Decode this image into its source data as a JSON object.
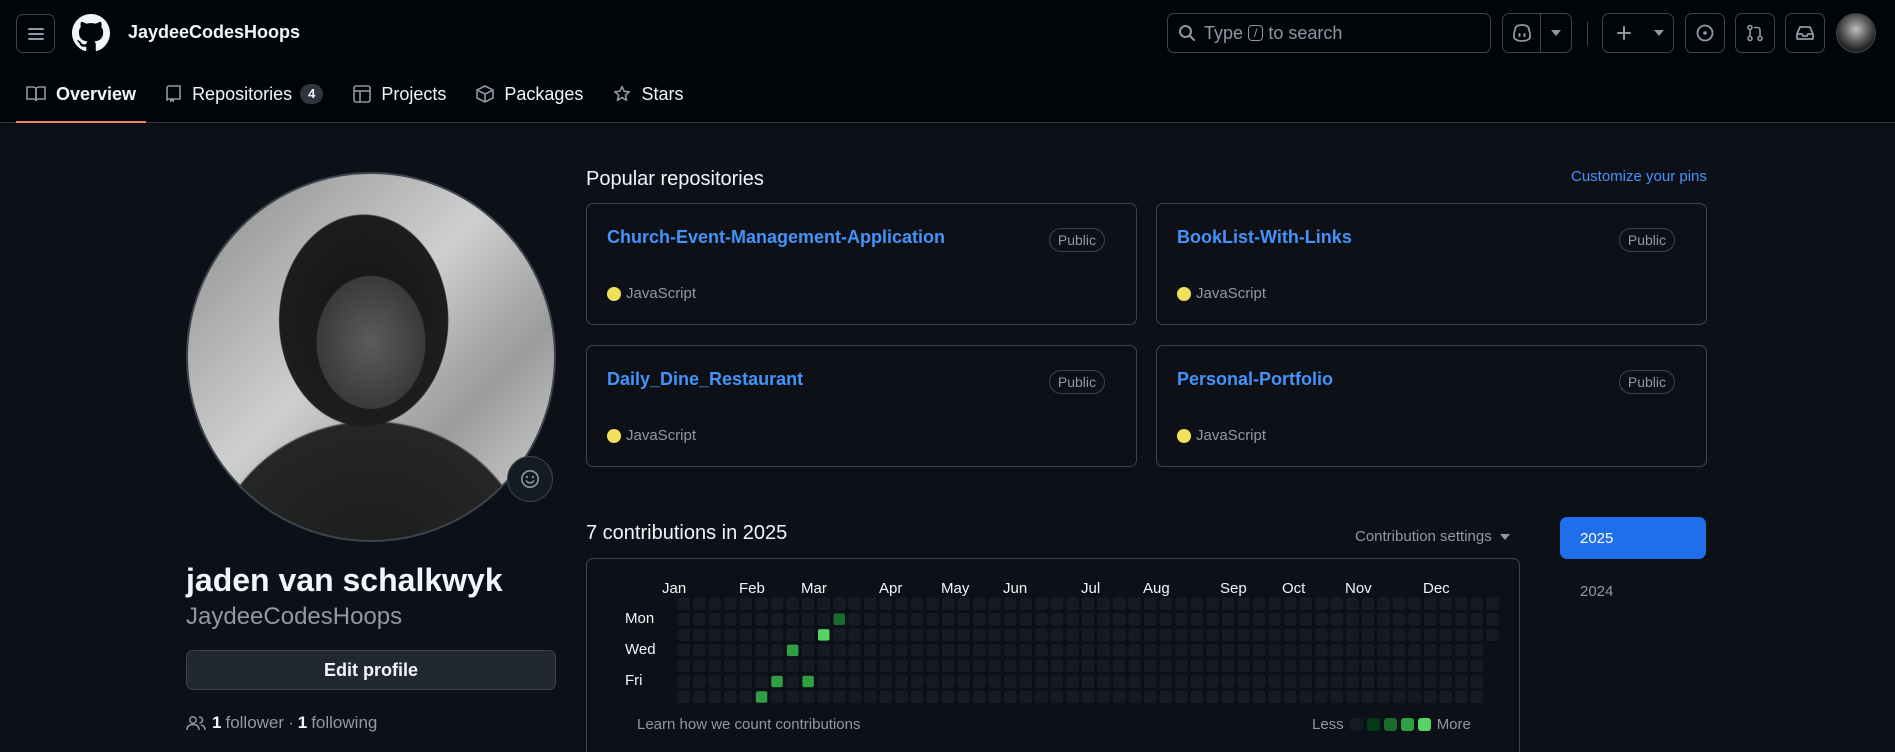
{
  "header": {
    "username": "JaydeeCodesHoops",
    "search": {
      "before": "Type",
      "key": "/",
      "after": "to search"
    }
  },
  "tabs": [
    {
      "label": "Overview",
      "icon": "book-icon",
      "active": true
    },
    {
      "label": "Repositories",
      "icon": "repo-icon",
      "count": "4"
    },
    {
      "label": "Projects",
      "icon": "table-icon"
    },
    {
      "label": "Packages",
      "icon": "package-icon"
    },
    {
      "label": "Stars",
      "icon": "star-icon"
    }
  ],
  "profile": {
    "full_name": "jaden van schalkwyk",
    "login": "JaydeeCodesHoops",
    "edit_label": "Edit profile",
    "followers_count": "1",
    "followers_label": "follower",
    "separator": "·",
    "following_count": "1",
    "following_label": "following"
  },
  "popular": {
    "title": "Popular repositories",
    "customize_label": "Customize your pins",
    "repos": [
      {
        "name": "Church-Event-Management-Application",
        "visibility": "Public",
        "language": "JavaScript"
      },
      {
        "name": "BookList-With-Links",
        "visibility": "Public",
        "language": "JavaScript"
      },
      {
        "name": "Daily_Dine_Restaurant",
        "visibility": "Public",
        "language": "JavaScript"
      },
      {
        "name": "Personal-Portfolio",
        "visibility": "Public",
        "language": "JavaScript"
      }
    ],
    "language_color": "#f1e05a"
  },
  "contributions": {
    "title": "7 contributions in 2025",
    "settings_label": "Contribution settings",
    "months": [
      "Jan",
      "Feb",
      "Mar",
      "Apr",
      "May",
      "Jun",
      "Jul",
      "Aug",
      "Sep",
      "Oct",
      "Nov",
      "Dec"
    ],
    "days": [
      "Mon",
      "Wed",
      "Fri"
    ],
    "learn_label": "Learn how we count contributions",
    "legend_less": "Less",
    "legend_more": "More",
    "legend_colors": [
      "#151b23",
      "#033a16",
      "#196c2e",
      "#2ea043",
      "#56d364"
    ],
    "years": [
      "2025",
      "2024"
    ],
    "selected_year": "2025",
    "active_days": [
      {
        "week": 5,
        "day": 6,
        "level": 3
      },
      {
        "week": 6,
        "day": 5,
        "level": 3
      },
      {
        "week": 7,
        "day": 3,
        "level": 3
      },
      {
        "week": 8,
        "day": 5,
        "level": 3
      },
      {
        "week": 9,
        "day": 2,
        "level": 4
      },
      {
        "week": 10,
        "day": 1,
        "level": 2
      }
    ]
  }
}
